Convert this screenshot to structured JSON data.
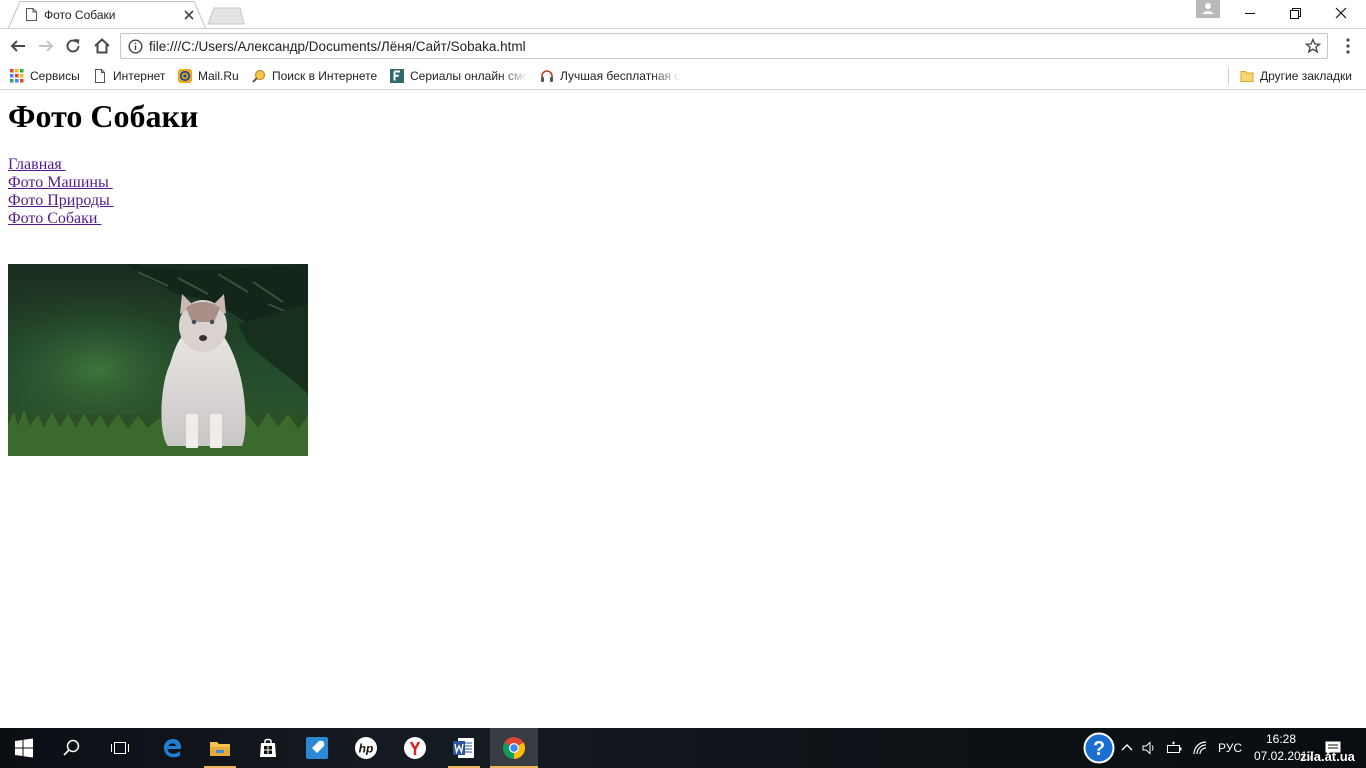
{
  "browser": {
    "tab": {
      "title": "Фото Собаки"
    },
    "address_bar": {
      "url": "file:///C:/Users/Александр/Documents/Лёня/Сайт/Sobaka.html"
    },
    "bookmarks": [
      {
        "label": "Сервисы",
        "icon": "apps-grid-icon"
      },
      {
        "label": "Интернет",
        "icon": "page-icon"
      },
      {
        "label": "Mail.Ru",
        "icon": "mailru-icon"
      },
      {
        "label": "Поиск в Интернете",
        "icon": "search-magnifier-icon"
      },
      {
        "label": "Сериалы онлайн смо",
        "icon": "f-site-icon"
      },
      {
        "label": "Лучшая бесплатная с",
        "icon": "headphones-icon"
      }
    ],
    "other_bookmarks": "Другие закладки"
  },
  "page": {
    "heading": "Фото Собаки",
    "nav": [
      {
        "label": "Главная "
      },
      {
        "label": "Фото Машины "
      },
      {
        "label": "Фото Природы "
      },
      {
        "label": "Фото Собаки "
      }
    ],
    "image": {
      "subject": "husky puppy sitting in grass"
    }
  },
  "taskbar": {
    "apps": [
      "start-icon",
      "search-icon",
      "task-view-icon",
      "edge-icon",
      "file-explorer-icon",
      "store-icon",
      "rocket-app-icon",
      "hp-icon",
      "yandex-icon",
      "word-icon",
      "chrome-icon"
    ],
    "language": "РУС",
    "time": "16:28",
    "date": "07.02.2017",
    "watermark": "zila.at.ua"
  },
  "colors": {
    "visited_link": "#551a8b",
    "taskbar_accent": "#e8b656"
  }
}
